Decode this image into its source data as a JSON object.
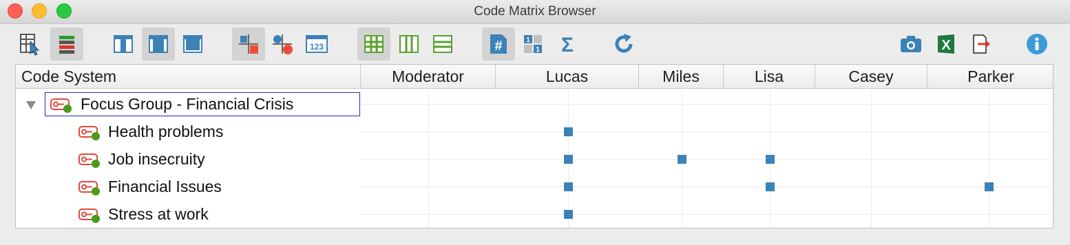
{
  "window": {
    "title": "Code Matrix Browser"
  },
  "toolbar": {
    "buttons": [
      {
        "name": "select-documents-icon",
        "active": false
      },
      {
        "name": "document-groups-icon",
        "active": true
      },
      {
        "name": "view-columns-left-icon",
        "active": false
      },
      {
        "name": "view-columns-middle-icon",
        "active": true
      },
      {
        "name": "view-columns-full-icon",
        "active": false
      },
      {
        "name": "symbols-view-icon",
        "active": true
      },
      {
        "name": "symbols-color-icon",
        "active": false
      },
      {
        "name": "numbers-view-icon",
        "active": false,
        "text": "123"
      },
      {
        "name": "grid-lines-icon",
        "active": true
      },
      {
        "name": "column-lines-icon",
        "active": false
      },
      {
        "name": "row-lines-icon",
        "active": false
      },
      {
        "name": "hash-count-icon",
        "active": true,
        "text": "#"
      },
      {
        "name": "binary-view-icon",
        "active": false
      },
      {
        "name": "sum-icon",
        "active": false,
        "text": "Σ"
      },
      {
        "name": "refresh-icon",
        "active": false
      },
      {
        "name": "camera-icon",
        "active": false
      },
      {
        "name": "excel-export-icon",
        "active": false,
        "text": "X"
      },
      {
        "name": "export-icon",
        "active": false
      },
      {
        "name": "info-icon",
        "active": false,
        "text": "i"
      }
    ]
  },
  "matrix": {
    "header": {
      "code_system": "Code System",
      "columns": [
        "Moderator",
        "Lucas",
        "Miles",
        "Lisa",
        "Casey",
        "Parker"
      ]
    },
    "rows": [
      {
        "label": "Focus Group - Financial Crisis",
        "level": 0,
        "expanded": true,
        "selected": true,
        "hits": []
      },
      {
        "label": "Health problems",
        "level": 1,
        "hits": [
          "Lucas"
        ]
      },
      {
        "label": "Job insecruity",
        "level": 1,
        "hits": [
          "Lucas",
          "Miles",
          "Lisa"
        ]
      },
      {
        "label": "Financial Issues",
        "level": 1,
        "hits": [
          "Lucas",
          "Lisa",
          "Parker"
        ]
      },
      {
        "label": "Stress at work",
        "level": 1,
        "hits": [
          "Lucas"
        ]
      }
    ]
  },
  "colors": {
    "hit_square": "#3c82b7",
    "code_icon_red": "#e04a3c",
    "code_icon_green": "#4c9a1a",
    "selection_border": "#2a2ab0"
  }
}
